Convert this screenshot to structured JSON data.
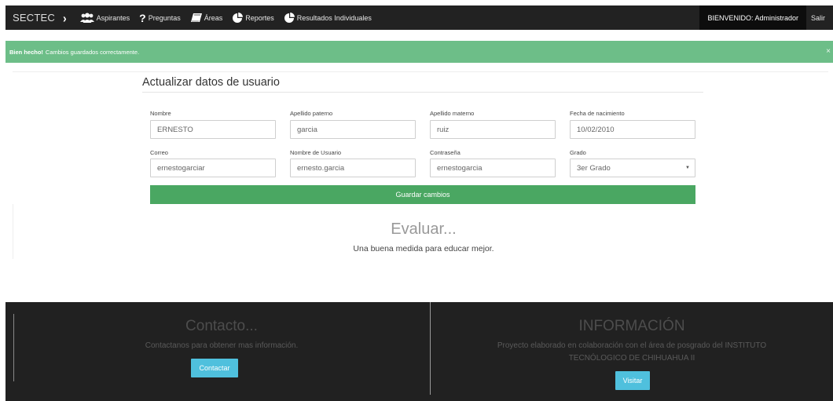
{
  "navbar": {
    "brand": "SECTEC",
    "chevron": "›",
    "items": [
      {
        "label": "Aspirantes",
        "icon": "users-icon"
      },
      {
        "label": "Preguntas",
        "icon": "question-icon"
      },
      {
        "label": "Áreas",
        "icon": "book-icon"
      },
      {
        "label": "Reportes",
        "icon": "pie-chart-icon"
      },
      {
        "label": "Resultados Individuales",
        "icon": "pie-chart-icon"
      }
    ],
    "welcome": "BIENVENIDO: Administrador",
    "logout": "Salir"
  },
  "alert": {
    "strong": "Bien hecho!",
    "message": "Cambios guardados correctamente.",
    "close": "×",
    "color": "#6dbe88"
  },
  "form": {
    "title": "Actualizar datos de usuario",
    "fields": {
      "nombre": {
        "label": "Nombre",
        "value": "ERNESTO"
      },
      "apellido_paterno": {
        "label": "Apellido paterno",
        "value": "garcia"
      },
      "apellido_materno": {
        "label": "Apellido materno",
        "value": "ruiz"
      },
      "fecha_nacimiento": {
        "label": "Fecha de nacimiento",
        "value": "10/02/2010"
      },
      "correo": {
        "label": "Correo",
        "value": "ernestogarciar"
      },
      "usuario": {
        "label": "Nombre de Usuario",
        "value": "ernesto.garcia"
      },
      "contrasena": {
        "label": "Contraseña",
        "value": "ernestogarcia"
      },
      "grado": {
        "label": "Grado",
        "value": "3er Grado"
      }
    },
    "save_label": "Guardar cambios",
    "save_color": "#4aa762"
  },
  "hero": {
    "title": "Evaluar...",
    "subtitle": "Una buena medida para educar mejor."
  },
  "footer": {
    "contact": {
      "title": "Contacto...",
      "text": "Contactanos para obtener mas información.",
      "button": "Contactar"
    },
    "info": {
      "title": "INFORMACIÓN",
      "text_line1": "Proyecto elaborado en colaboración con el área de posgrado del INSTITUTO",
      "text_line2": "TECNÓLOGICO DE CHIHUAHUA II",
      "button": "Visitar"
    },
    "button_color": "#4fc0dd"
  }
}
